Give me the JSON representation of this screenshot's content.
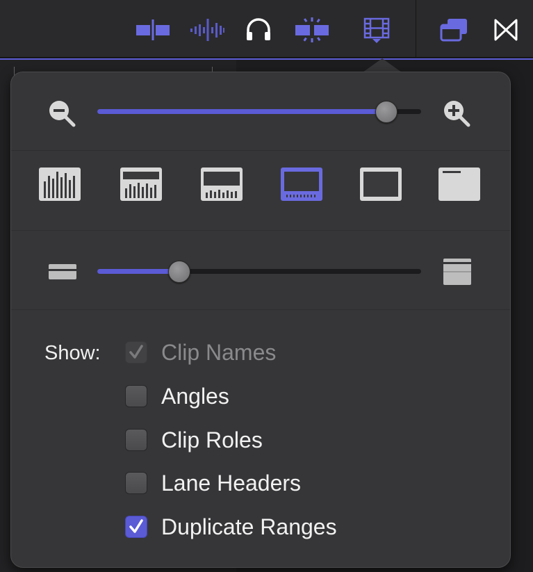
{
  "toolbar": {
    "icons": [
      {
        "name": "skimming-icon",
        "color": "#6a6ae0",
        "active": true
      },
      {
        "name": "audio-skimming-icon",
        "color": "#5a5ac8",
        "active": true
      },
      {
        "name": "headphones-icon",
        "color": "#ffffff",
        "active": false
      },
      {
        "name": "snapping-icon",
        "color": "#6a6ae0",
        "active": true
      },
      {
        "name": "clip-appearance-icon",
        "color": "#6a6ae0",
        "active": true
      },
      {
        "name": "inspector-windows-icon",
        "color": "#6a6ae0",
        "active": true
      },
      {
        "name": "transitions-icon",
        "color": "#ffffff",
        "active": false
      }
    ]
  },
  "popover": {
    "zoom_slider": {
      "value": 0.89,
      "left_icon": "zoom-out-icon",
      "right_icon": "zoom-in-icon"
    },
    "clip_presets": [
      {
        "name": "audio-waveforms-only",
        "selected": false
      },
      {
        "name": "large-waveforms",
        "selected": false
      },
      {
        "name": "equal-waveforms-filmstrips",
        "selected": false
      },
      {
        "name": "large-filmstrips",
        "selected": true
      },
      {
        "name": "filmstrips-only",
        "selected": false
      },
      {
        "name": "clip-labels-only",
        "selected": false
      }
    ],
    "height_slider": {
      "value": 0.25,
      "left_icon": "small-clip-height-icon",
      "right_icon": "large-clip-height-icon"
    },
    "show_label": "Show:",
    "options": [
      {
        "label": "Clip Names",
        "checked": true,
        "disabled": true
      },
      {
        "label": "Angles",
        "checked": false,
        "disabled": false
      },
      {
        "label": "Clip Roles",
        "checked": false,
        "disabled": false
      },
      {
        "label": "Lane Headers",
        "checked": false,
        "disabled": false
      },
      {
        "label": "Duplicate Ranges",
        "checked": true,
        "disabled": false
      }
    ]
  },
  "colors": {
    "accent": "#5b5bd6",
    "popover_bg": "#363638",
    "toolbar_bg": "#2a2a2c"
  }
}
